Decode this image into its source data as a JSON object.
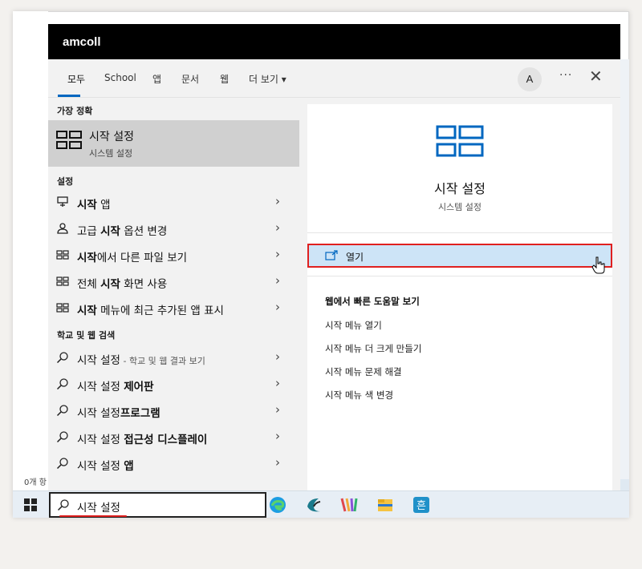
{
  "app": {
    "brand": "amcoll"
  },
  "desktop": {
    "corner_text": "0개 항"
  },
  "tabs": [
    {
      "label": "모두",
      "active": true
    },
    {
      "label": "School"
    },
    {
      "label": "앱"
    },
    {
      "label": "문서"
    },
    {
      "label": "웹"
    },
    {
      "label": "더 보기 ▾"
    }
  ],
  "header": {
    "avatar_letter": "A",
    "more": "···",
    "close": "✕"
  },
  "best_match": {
    "heading": "가장 정확",
    "title": "시작 설정",
    "subtitle": "시스템 설정"
  },
  "settings": {
    "heading": "설정",
    "items": [
      {
        "pre": "",
        "bold": "시작",
        "post": " 앱",
        "icon": "app-list-icon"
      },
      {
        "pre": "고급 ",
        "bold": "시작",
        "post": " 옵션 변경",
        "icon": "person-icon"
      },
      {
        "pre": "",
        "bold": "시작",
        "post": "에서 다른 파일 보기",
        "icon": "start-icon"
      },
      {
        "pre": "전체 ",
        "bold": "시작",
        "post": " 화면 사용",
        "icon": "start-icon"
      },
      {
        "pre": "",
        "bold": "시작",
        "post": " 메뉴에 최근 추가된 앱 표시",
        "icon": "start-icon"
      }
    ]
  },
  "web": {
    "heading": "학교 및 웹 검색",
    "items": [
      {
        "pre": "시작 설정",
        "bold": "",
        "post": "",
        "small": " - 학교 및 웹 결과 보기"
      },
      {
        "pre": "시작 설정 ",
        "bold": "제어판",
        "post": "",
        "small": ""
      },
      {
        "pre": "시작 설정",
        "bold": "프로그램",
        "post": "",
        "small": ""
      },
      {
        "pre": "시작 설정 ",
        "bold": "접근성 디스플레이",
        "post": "",
        "small": ""
      },
      {
        "pre": "시작 설정 ",
        "bold": "앱",
        "post": "",
        "small": ""
      }
    ]
  },
  "preview": {
    "title": "시작 설정",
    "subtitle": "시스템 설정",
    "open_label": "열기",
    "help_heading": "웹에서 빠른 도움말 보기",
    "help_links": [
      "시작 메뉴 열기",
      "시작 메뉴 더 크게 만들기",
      "시작 메뉴 문제 해결",
      "시작 메뉴 색 변경"
    ]
  },
  "search": {
    "query": "시작 설정"
  },
  "taskbar_apps": [
    "edge-icon",
    "app-icon",
    "app-icon",
    "file-explorer-icon",
    "hangul-icon"
  ],
  "colors": {
    "accent": "#0067c0",
    "highlight": "#e0201f"
  }
}
